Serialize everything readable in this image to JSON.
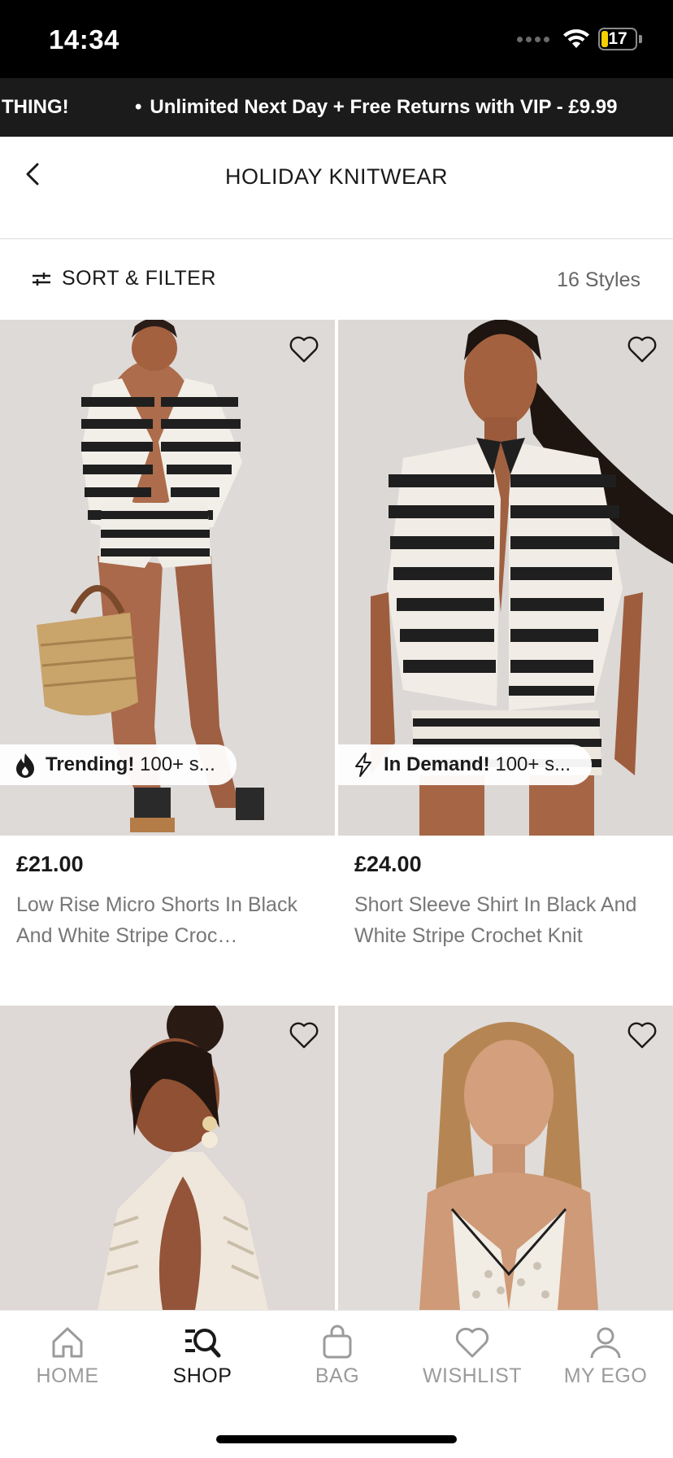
{
  "status_bar": {
    "time": "14:34",
    "battery": "17"
  },
  "promo": {
    "prev_fragment": "THING!",
    "message": "Unlimited Next Day + Free Returns with VIP - £9.99"
  },
  "header": {
    "title": "HOLIDAY KNITWEAR",
    "back_icon": "chevron-left-icon"
  },
  "filter": {
    "sort_filter_label": "SORT & FILTER",
    "styles_count": "16 Styles"
  },
  "products": [
    {
      "price": "£21.00",
      "name": "Low Rise Micro Shorts In Black And White Stripe Croc…",
      "badge_icon": "flame-icon",
      "badge_strong": "Trending!",
      "badge_rest": "100+ s..."
    },
    {
      "price": "£24.00",
      "name": "Short Sleeve Shirt In Black And White Stripe Crochet Knit",
      "badge_icon": "lightning-icon",
      "badge_strong": "In Demand!",
      "badge_rest": "100+ s..."
    },
    {
      "price": "",
      "name": ""
    },
    {
      "price": "",
      "name": ""
    }
  ],
  "tabbar": {
    "items": [
      {
        "label": "HOME",
        "icon": "home-icon"
      },
      {
        "label": "SHOP",
        "icon": "shop-search-icon"
      },
      {
        "label": "BAG",
        "icon": "bag-icon"
      },
      {
        "label": "WISHLIST",
        "icon": "heart-icon"
      },
      {
        "label": "MY EGO",
        "icon": "profile-icon"
      }
    ],
    "active": "SHOP"
  }
}
